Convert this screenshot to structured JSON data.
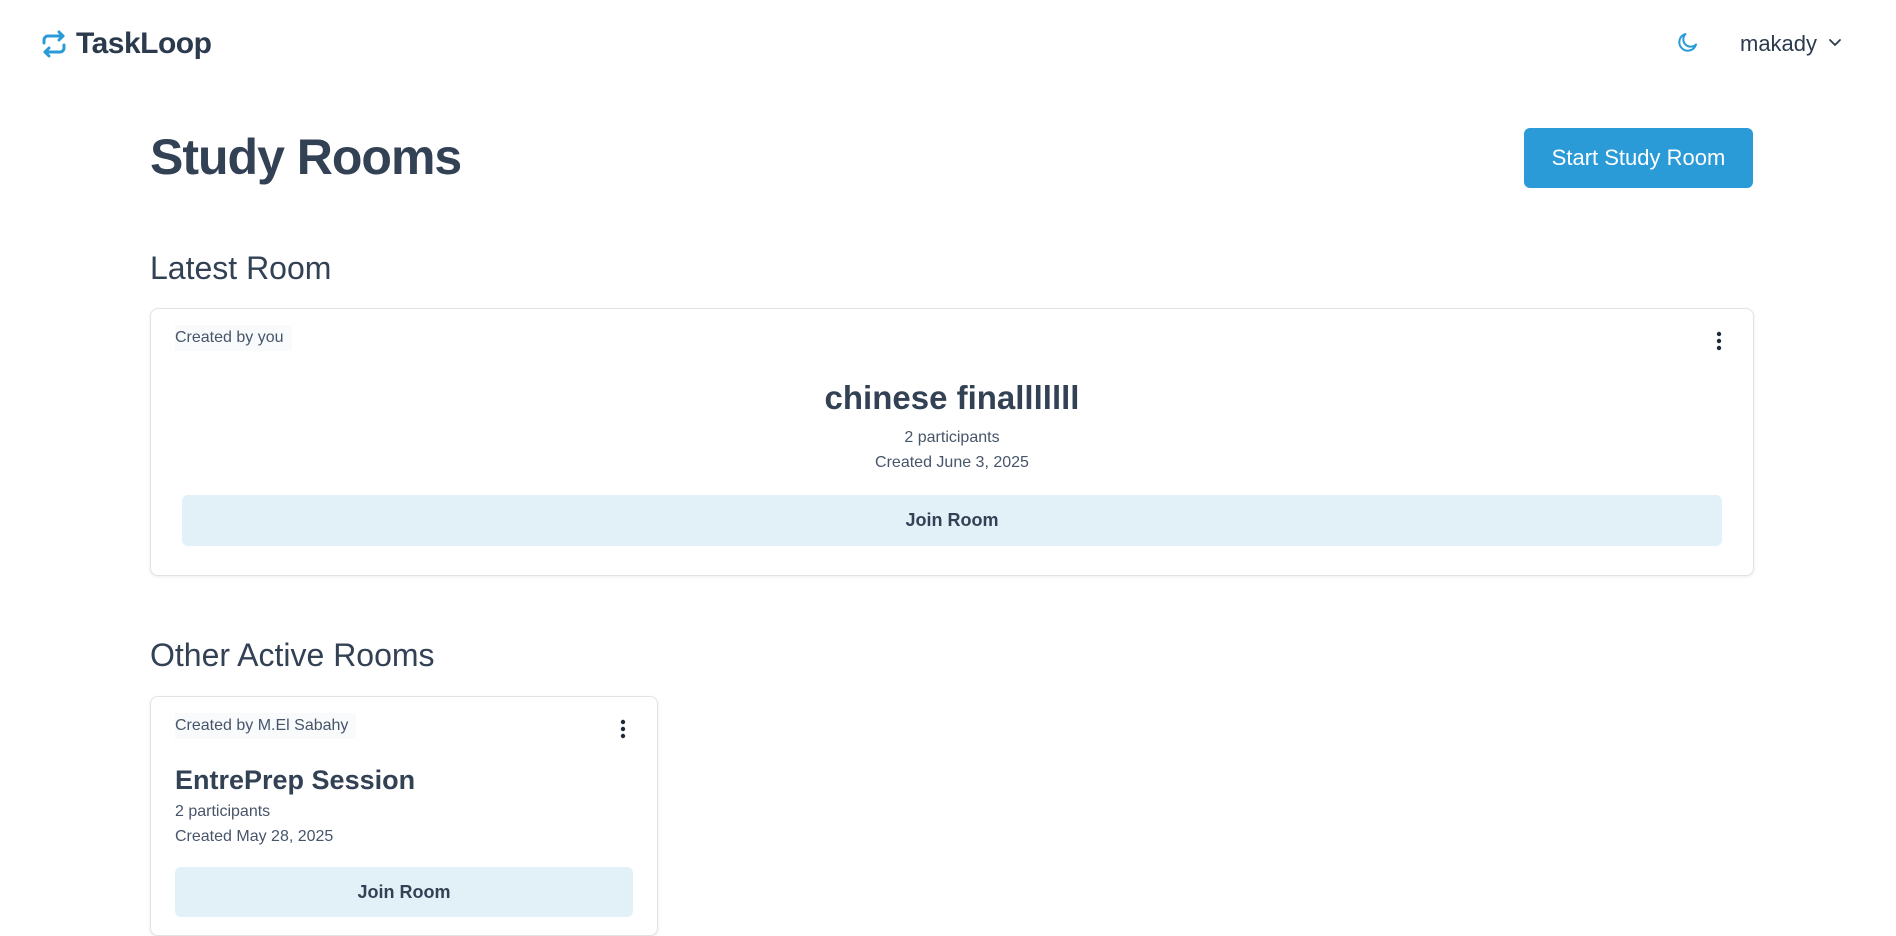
{
  "app": {
    "name": "TaskLoop"
  },
  "header": {
    "theme_icon": "moon-icon",
    "user": {
      "name": "makady",
      "menu_icon": "chevron-down-icon"
    }
  },
  "page": {
    "title": "Study Rooms",
    "start_button_label": "Start Study Room"
  },
  "latest": {
    "section_title": "Latest Room",
    "room": {
      "creator": "Created by you",
      "title": "chinese finalllllll",
      "participants": "2 participants",
      "created": "Created June 3, 2025",
      "join_label": "Join Room"
    }
  },
  "others": {
    "section_title": "Other Active Rooms",
    "rooms": [
      {
        "creator": "Created by M.El Sabahy",
        "title": "EntrePrep Session",
        "participants": "2 participants",
        "created": "Created May 28, 2025",
        "join_label": "Join Room"
      }
    ]
  },
  "colors": {
    "accent": "#2b9bd8",
    "join_bg": "#e2f1f8",
    "text": "#334155"
  }
}
